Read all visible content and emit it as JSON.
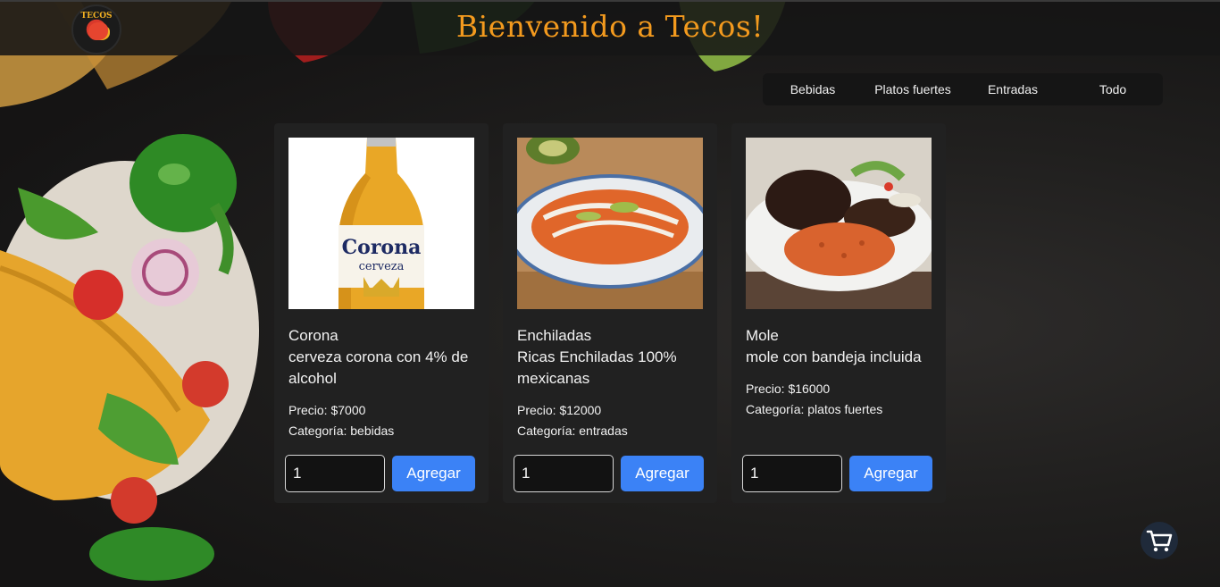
{
  "header": {
    "title": "Bienvenido a Tecos!",
    "logo_text": "TECOS"
  },
  "filters": [
    {
      "label": "Bebidas"
    },
    {
      "label": "Platos fuertes"
    },
    {
      "label": "Entradas"
    },
    {
      "label": "Todo"
    }
  ],
  "products": [
    {
      "name": "Corona",
      "description": "cerveza corona con 4% de alcohol",
      "price_label": "Precio: $7000",
      "category_label": "Categoría: bebidas",
      "quantity": "1",
      "add_label": "Agregar",
      "image_label": "Corona",
      "image_sublabel": "cerveza",
      "image_icon": "beer-bottle"
    },
    {
      "name": "Enchiladas",
      "description": "Ricas Enchiladas 100% mexicanas",
      "price_label": "Precio: $12000",
      "category_label": "Categoría: entradas",
      "quantity": "1",
      "add_label": "Agregar",
      "image_icon": "enchiladas-plate"
    },
    {
      "name": "Mole",
      "description": "mole con bandeja incluida",
      "price_label": "Precio: $16000",
      "category_label": "Categoría: platos fuertes",
      "quantity": "1",
      "add_label": "Agregar",
      "image_icon": "mole-plate"
    }
  ],
  "cart": {
    "icon": "cart-icon"
  },
  "colors": {
    "accent": "#3b82f6",
    "title": "#f39a1e",
    "card_bg": "#212121"
  }
}
